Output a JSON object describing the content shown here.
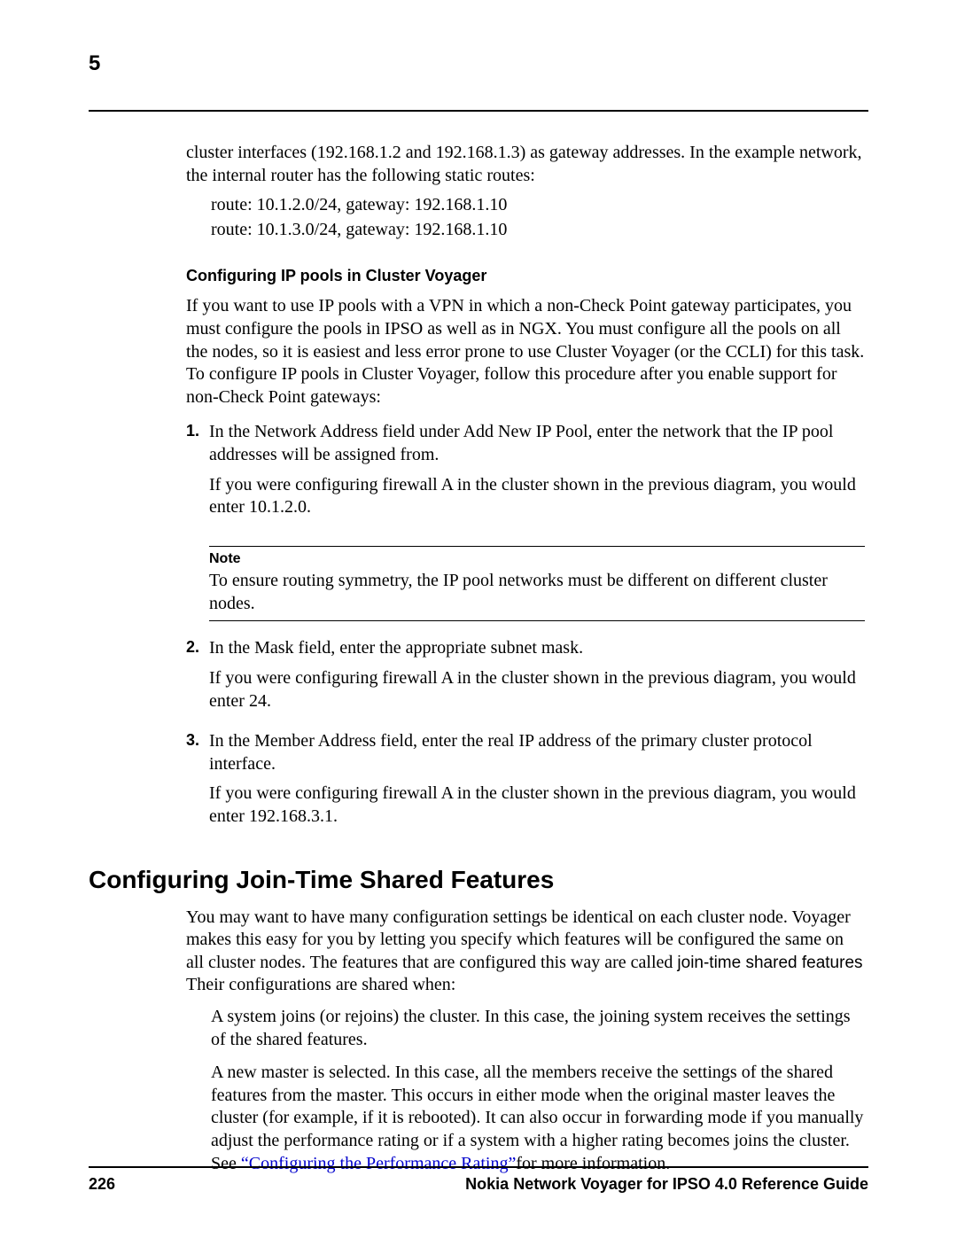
{
  "chapter_number": "5",
  "intro": {
    "p1": "cluster interfaces (192.168.1.2 and 192.168.1.3) as gateway addresses. In the example network, the internal router has the following static routes:",
    "route1": "route: 10.1.2.0/24, gateway: 192.168.1.10",
    "route2": "route: 10.1.3.0/24, gateway: 192.168.1.10"
  },
  "sub_heading": "Configuring IP pools in Cluster Voyager",
  "sub_intro": "If you want to use IP pools with a VPN in which a non-Check Point gateway participates, you must configure the pools in IPSO as well as in NGX. You must configure all the pools on all the nodes, so it is easiest and less error prone to use Cluster Voyager (or the CCLI) for this task. To configure IP pools in Cluster Voyager, follow this procedure after you enable support for non-Check Point gateways:",
  "steps": {
    "s1_num": "1.",
    "s1_a": "In the Network Address field under Add New IP Pool, enter the network that the IP pool addresses will be assigned from.",
    "s1_b": "If you were configuring firewall A in the cluster shown in the previous diagram, you would enter 10.1.2.0.",
    "note_label": "Note",
    "note_text": "To ensure routing symmetry, the IP pool networks must be different on different cluster nodes.",
    "s2_num": "2.",
    "s2_a": "In the Mask field, enter the appropriate subnet mask.",
    "s2_b": "If you were configuring firewall A in the cluster shown in the previous diagram, you would enter 24.",
    "s3_num": "3.",
    "s3_a": "In the Member Address field, enter the real IP address of the primary cluster protocol interface.",
    "s3_b": "If you were configuring firewall A in the cluster shown in the previous diagram, you would enter 192.168.3.1."
  },
  "section_heading": "Configuring Join-Time Shared Features",
  "join": {
    "p1_a": "You may want to have many configuration settings be identical on each cluster node. Voyager makes this easy for you by letting you specify which features will be configured the same on all cluster nodes. The features that are configured this way are called ",
    "p1_b": "join-time shared features",
    "p1_c": " Their configurations are shared when:",
    "b1": "A system joins (or rejoins) the cluster. In this case, the joining system receives the settings of the shared features.",
    "b2_a": "A new master is selected. In this case, all the members receive the settings of the shared features from the master. This occurs in either mode when the original master leaves the cluster (for example, if it is rebooted). It can also occur in forwarding mode if you manually adjust the performance rating or if a system with a higher rating becomes joins the cluster. See ",
    "b2_link": "“Configuring the Performance Rating”",
    "b2_b": "for more information."
  },
  "footer": {
    "page": "226",
    "title": "Nokia Network Voyager for IPSO 4.0 Reference Guide"
  }
}
